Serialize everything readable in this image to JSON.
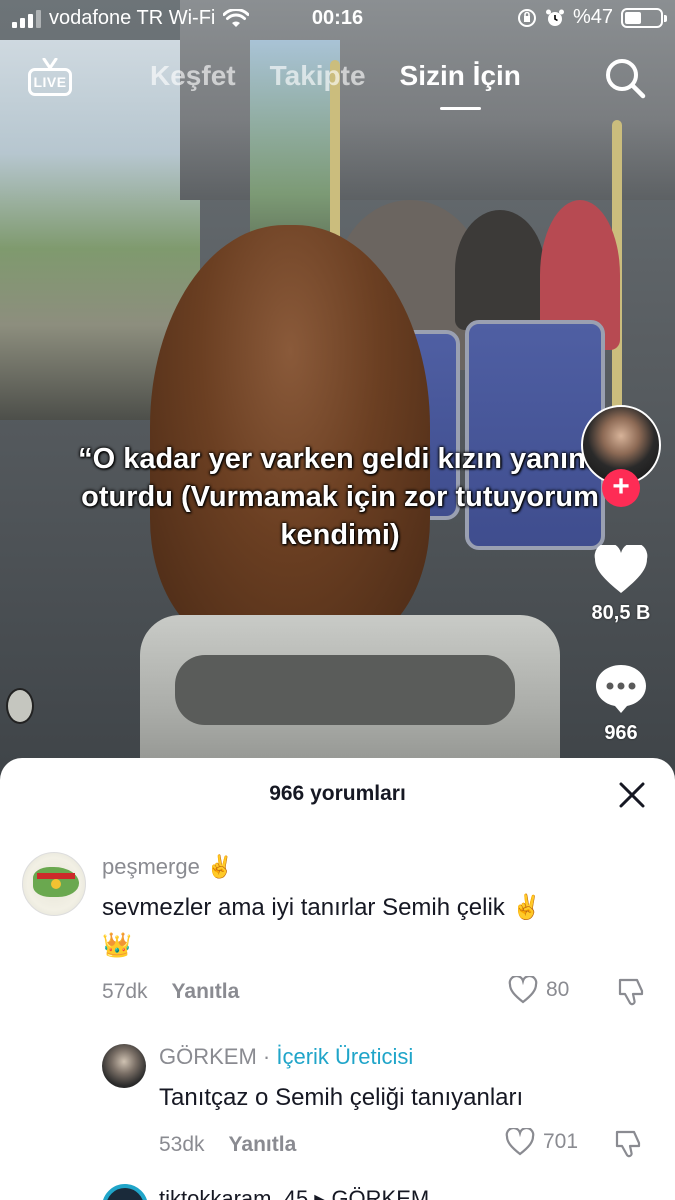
{
  "status_bar": {
    "carrier": "vodafone TR Wi-Fi",
    "time": "00:16",
    "battery": "%47",
    "battery_level": 0.47
  },
  "top_nav": {
    "live_label": "LIVE",
    "tabs": [
      {
        "label": "Keşfet",
        "active": false
      },
      {
        "label": "Takipte",
        "active": false
      },
      {
        "label": "Sizin İçin",
        "active": true
      }
    ]
  },
  "video": {
    "caption": "“O kadar yer varken geldi kızın yanına oturdu (Vurmamak için zor tutuyorum kendimi)"
  },
  "actions": {
    "like_count": "80,5 B",
    "comment_count": "966",
    "follow_symbol": "+"
  },
  "comments_sheet": {
    "title": "966 yorumları",
    "comments": [
      {
        "username": "peşmerge ✌️",
        "text_line1": "sevmezler ama iyi tanırlar Semih çelik ✌️",
        "text_line2": "👑",
        "time": "57dk",
        "reply_label": "Yanıtla",
        "likes": "80"
      },
      {
        "username": "GÖRKEM",
        "separator": " · ",
        "badge": "İçerik Üreticisi",
        "text": "Tanıtçaz o Semih çeliği tanıyanları",
        "time": "53dk",
        "reply_label": "Yanıtla",
        "likes": "701"
      },
      {
        "username": "tiktokkaram_45 ▸ GÖRKEM"
      }
    ]
  },
  "colors": {
    "accent": "#fe2c55",
    "creator_badge": "#20a5c9",
    "muted_text": "#8a8b91"
  }
}
